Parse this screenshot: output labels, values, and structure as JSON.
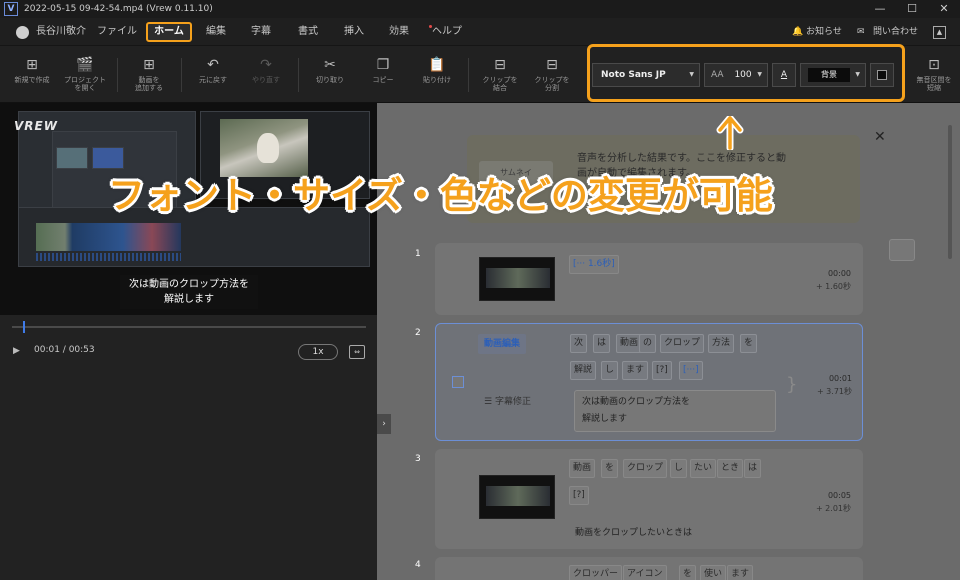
{
  "titlebar": {
    "app_logo": "V",
    "title": "2022-05-15 09-42-54.mp4 (Vrew 0.11.10)",
    "minimize": "—",
    "maximize": "☐",
    "close": "✕"
  },
  "menubar": {
    "user_name": "長谷川敬介",
    "items": [
      "ファイル",
      "ホーム",
      "編集",
      "字幕",
      "書式",
      "挿入",
      "効果",
      "ヘルプ"
    ],
    "active_item": "ホーム",
    "notifications": "お知らせ",
    "contact": "問い合わせ"
  },
  "toolbar": {
    "tools": [
      {
        "icon": "new-project-icon",
        "glyph": "⊞",
        "label": "新規で作成"
      },
      {
        "icon": "open-project-icon",
        "glyph": "🎬",
        "label": "プロジェクト\nを開く"
      },
      {
        "icon": "add-video-icon",
        "glyph": "⊞",
        "label": "動画を\n追加する"
      },
      {
        "icon": "undo-icon",
        "glyph": "↶",
        "label": "元に戻す"
      },
      {
        "icon": "redo-icon",
        "glyph": "↷",
        "label": "やり直す"
      },
      {
        "icon": "scissors-icon",
        "glyph": "✂",
        "label": "切り取り"
      },
      {
        "icon": "copy-icon",
        "glyph": "❐",
        "label": "コピー"
      },
      {
        "icon": "paste-icon",
        "glyph": "📋",
        "label": "貼り付け"
      },
      {
        "icon": "merge-clip-icon",
        "glyph": "⊟",
        "label": "クリップを\n結合"
      },
      {
        "icon": "split-clip-icon",
        "glyph": "⊟",
        "label": "クリップを\n分割"
      },
      {
        "icon": "silence-cut-icon",
        "glyph": "⊡",
        "label": "無音区間を\n短縮"
      }
    ],
    "font_family": "Noto Sans JP",
    "font_size_icon": "AA",
    "font_size": "100",
    "font_color_icon": "A",
    "background_label": "背景"
  },
  "preview": {
    "logo": "VREW",
    "subtitle": "次は動画のクロップ方法を\n解説します",
    "timecode": "00:01 / 00:53",
    "speed": "1x",
    "fit_icon": "⇔",
    "seek_progress": 0.03
  },
  "notice": {
    "thumb_label": "サムネイ",
    "text": "音声を分析した結果です。ここを修正すると動\n画が自動で編集されます。"
  },
  "clips": [
    {
      "number": "1",
      "words": [
        "[··· 1.6秒]"
      ],
      "time": "00:00",
      "duration": "+ 1.60秒"
    },
    {
      "number": "2",
      "tag_video": "動画編集",
      "words": [
        "次",
        "は",
        "動画",
        "の",
        "クロップ",
        "方法",
        "を",
        "解説",
        "し",
        "ます",
        "[?]",
        "[···]"
      ],
      "tag_sub": "字幕修正",
      "subtitle": "次は動画のクロップ方法を\n解説します",
      "time": "00:01",
      "duration": "+ 3.71秒"
    },
    {
      "number": "3",
      "words": [
        "動画",
        "を",
        "クロップ",
        "し",
        "たい",
        "とき",
        "は",
        "[?]"
      ],
      "caption": "動画をクロップしたいときは",
      "time": "00:05",
      "duration": "+ 2.01秒"
    },
    {
      "number": "4",
      "words": [
        "クロッパー",
        "アイコン",
        "を",
        "使い",
        "ます"
      ]
    }
  ],
  "annotation": {
    "caption": "フォント・サイズ・色などの変更が可能"
  },
  "colors": {
    "accent": "#f5a11c",
    "selection": "#6c8fd6",
    "link_blue": "#2c5fb8"
  }
}
